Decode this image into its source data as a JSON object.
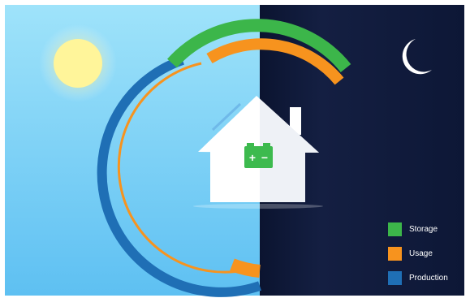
{
  "scene": {
    "sky_day_top": "#9fe3fa",
    "sky_day_bottom": "#5ec0f2",
    "sky_night_top": "#111a38",
    "sky_night_bottom": "#0d1736",
    "sun_color": "#fff59a",
    "moon_color": "#ffffff",
    "house_color": "#ffffff",
    "battery_color": "#3dba4e"
  },
  "legend": {
    "items": [
      {
        "label": "Storage",
        "color": "#3cb64a"
      },
      {
        "label": "Usage",
        "color": "#f7931e"
      },
      {
        "label": "Production",
        "color": "#1f6fb5"
      }
    ]
  },
  "battery": {
    "plus": "+",
    "minus": "−"
  }
}
